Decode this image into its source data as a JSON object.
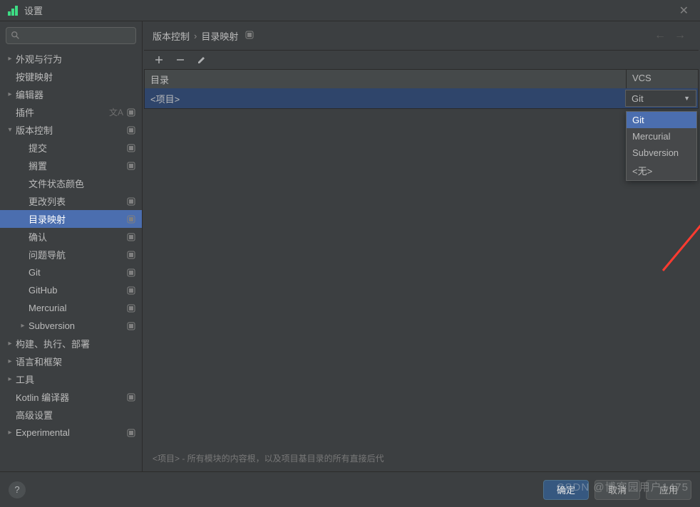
{
  "window": {
    "title": "设置"
  },
  "search": {
    "placeholder": ""
  },
  "sidebar": {
    "items": [
      {
        "label": "外观与行为",
        "indent": 1,
        "chev": "right",
        "badge": false
      },
      {
        "label": "按键映射",
        "indent": 1,
        "chev": "",
        "badge": false
      },
      {
        "label": "编辑器",
        "indent": 1,
        "chev": "right",
        "badge": false
      },
      {
        "label": "插件",
        "indent": 1,
        "chev": "",
        "badge": true,
        "lang": true
      },
      {
        "label": "版本控制",
        "indent": 1,
        "chev": "down",
        "badge": true
      },
      {
        "label": "提交",
        "indent": 2,
        "chev": "",
        "badge": true
      },
      {
        "label": "搁置",
        "indent": 2,
        "chev": "",
        "badge": true
      },
      {
        "label": "文件状态颜色",
        "indent": 2,
        "chev": "",
        "badge": false
      },
      {
        "label": "更改列表",
        "indent": 2,
        "chev": "",
        "badge": true
      },
      {
        "label": "目录映射",
        "indent": 2,
        "chev": "",
        "badge": true,
        "selected": true
      },
      {
        "label": "确认",
        "indent": 2,
        "chev": "",
        "badge": true
      },
      {
        "label": "问题导航",
        "indent": 2,
        "chev": "",
        "badge": true
      },
      {
        "label": "Git",
        "indent": 2,
        "chev": "",
        "badge": true
      },
      {
        "label": "GitHub",
        "indent": 2,
        "chev": "",
        "badge": true
      },
      {
        "label": "Mercurial",
        "indent": 2,
        "chev": "",
        "badge": true
      },
      {
        "label": "Subversion",
        "indent": 2,
        "chev": "right",
        "badge": true
      },
      {
        "label": "构建、执行、部署",
        "indent": 1,
        "chev": "right",
        "badge": false
      },
      {
        "label": "语言和框架",
        "indent": 1,
        "chev": "right",
        "badge": false
      },
      {
        "label": "工具",
        "indent": 1,
        "chev": "right",
        "badge": false
      },
      {
        "label": "Kotlin 编译器",
        "indent": 1,
        "chev": "",
        "badge": true
      },
      {
        "label": "高级设置",
        "indent": 1,
        "chev": "",
        "badge": false
      },
      {
        "label": "Experimental",
        "indent": 1,
        "chev": "right",
        "badge": true
      }
    ]
  },
  "breadcrumb": {
    "part1": "版本控制",
    "part2": "目录映射"
  },
  "table": {
    "headers": {
      "dir": "目录",
      "vcs": "VCS"
    },
    "row": {
      "dir": "<项目>",
      "vcs": "Git"
    }
  },
  "dropdown": {
    "options": [
      "Git",
      "Mercurial",
      "Subversion",
      "<无>"
    ],
    "selected": "Git"
  },
  "hint": "<项目> - 所有模块的内容根，以及项目基目录的所有直接后代",
  "footer": {
    "ok": "确定",
    "cancel": "取消",
    "apply": "应用"
  },
  "watermark": "CSDN @博客园用户1475"
}
